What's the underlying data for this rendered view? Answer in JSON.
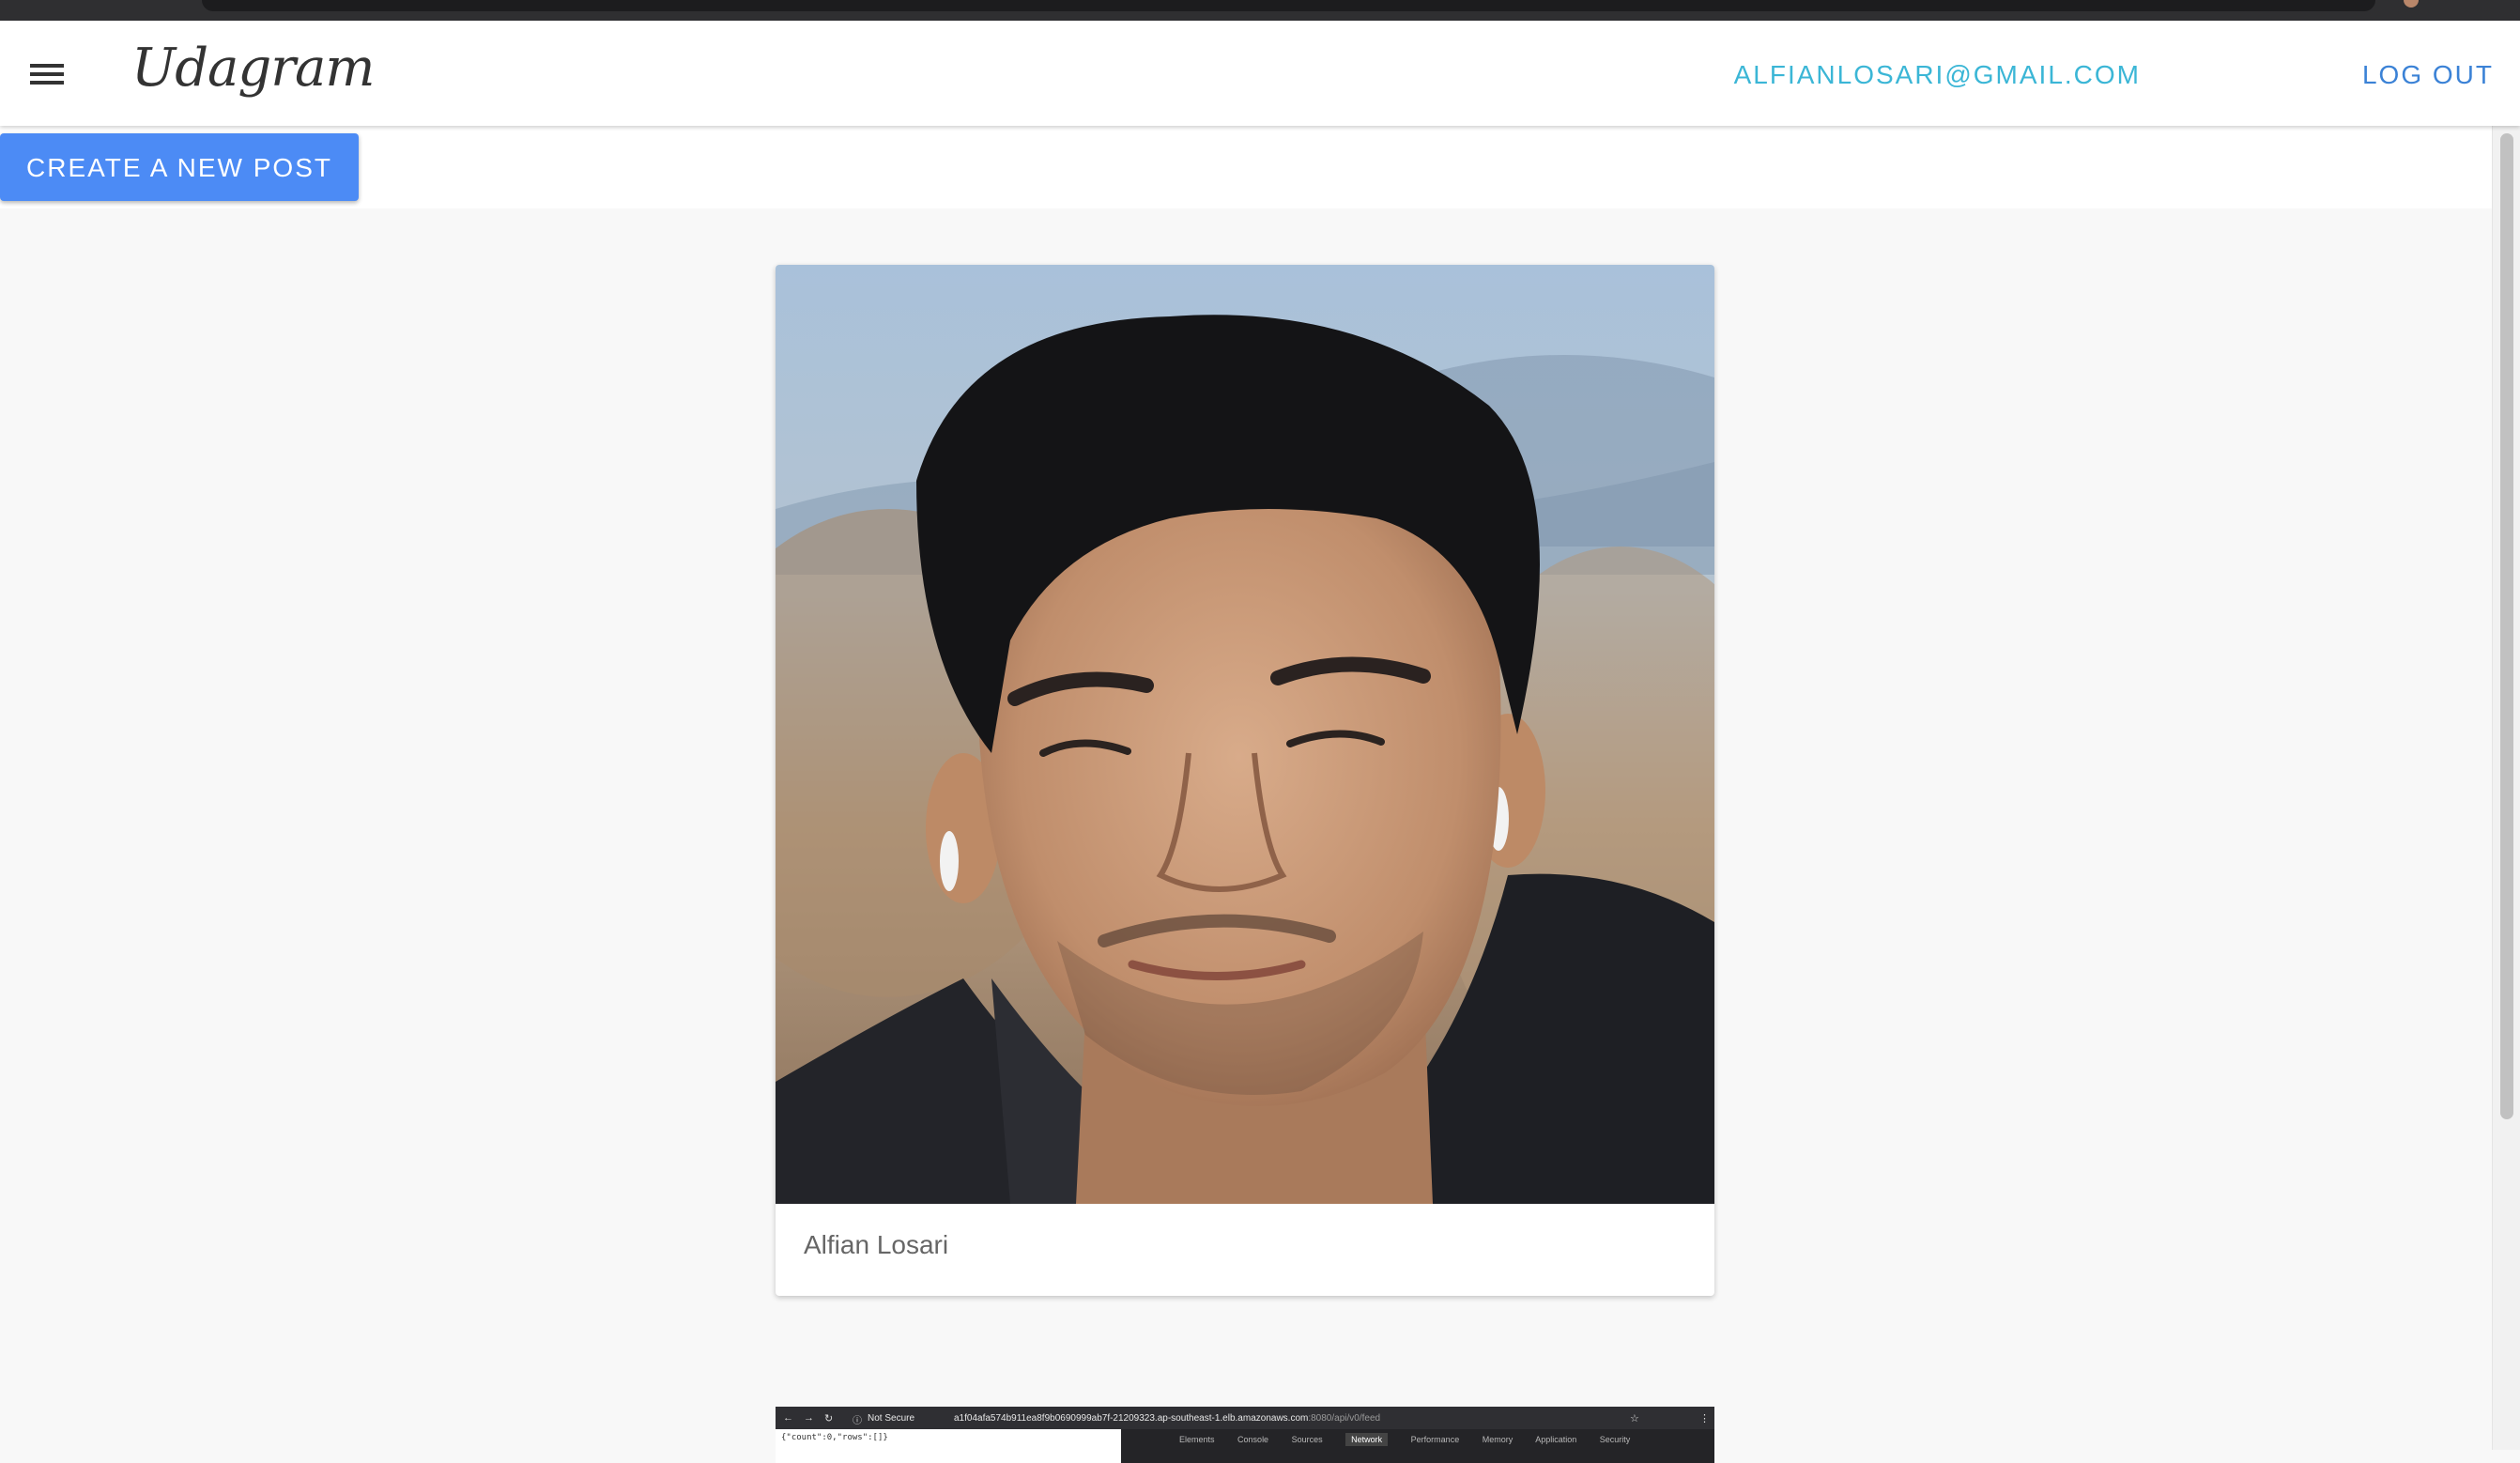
{
  "header": {
    "brand": "Udagram",
    "user_email": "ALFIANLOSARI@GMAIL.COM",
    "logout_label": "LOG OUT"
  },
  "actions": {
    "create_post_label": "CREATE A NEW POST"
  },
  "feed": {
    "posts": [
      {
        "caption": "Alfian Losari",
        "image": "portrait photo of a man outdoors"
      },
      {
        "caption": "",
        "image": "browser screenshot",
        "embedded": {
          "security": "Not Secure",
          "url_host": "a1f04afa574b911ea8f9b0690999ab7f-21209323.ap-southeast-1.elb.amazonaws.com",
          "url_path": ":8080/api/v0/feed",
          "json_snippet": "{\"count\":0,\"rows\":[]}",
          "devtools_tabs": [
            "Elements",
            "Console",
            "Sources",
            "Network",
            "Performance",
            "Memory",
            "Application",
            "Security"
          ],
          "active_tab": "Network"
        }
      }
    ]
  },
  "colors": {
    "email_link": "#3bb6d6",
    "logout_link": "#3b82d6",
    "primary_button": "#4c8bf5"
  }
}
